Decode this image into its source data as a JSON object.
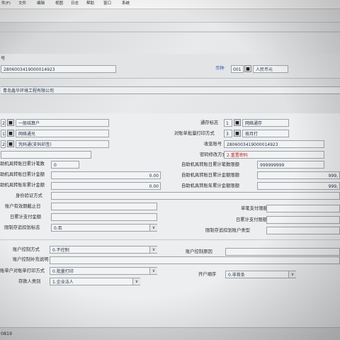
{
  "menu": {
    "items": [
      "件(F)",
      "文件",
      "编辑",
      "视图",
      "日志",
      "帮助",
      "窗口",
      "系统"
    ]
  },
  "header": {
    "label_fragment": "号",
    "account_value": "2806003419000014923",
    "currency_label": "币种",
    "currency_code": "001",
    "currency_name": "人民币元"
  },
  "customer": {
    "name": "青岛鑫华环境工程有限公司"
  },
  "left": {
    "field1": {
      "code": "2",
      "value": "一般结算户"
    },
    "field2": {
      "code": "1",
      "value": "网络通兑"
    },
    "field3": {
      "code": "2",
      "value": "凭码通(支码印签)"
    }
  },
  "right": {
    "transfer_flag": {
      "label": "通存标志",
      "code": "1",
      "value": "网络通存"
    },
    "print_mode": {
      "label": "对账单批量打印方式",
      "code": "3",
      "value": "按月打"
    },
    "receipt_account": {
      "label": "收息账号",
      "value": "2806003419000014923"
    },
    "password_change": {
      "label": "密码修改方式",
      "value": "2.重置密码"
    }
  },
  "limits": {
    "row1": {
      "left_label": "助机具转账日累计笔数",
      "left_value": "0",
      "right_label": "自助机具转账日累计笔数限额",
      "right_value": "999999999"
    },
    "row2": {
      "left_label": "助机具转账日累计金额",
      "left_value": "0.00",
      "right_label": "自助机具转账日累计金额限额",
      "right_value": "999,"
    },
    "row3": {
      "left_label": "助机具转账年累计金额",
      "left_value": "0.00",
      "right_label": "自助机具转账年累计金额限额",
      "right_value": "999,"
    }
  },
  "verify": {
    "label": "身份验证方式"
  },
  "misc": {
    "expiry_label": "账户有效期截止日",
    "single_limit_label": "单笔支付限额",
    "daily_amount_label": "日累计支付金额",
    "daily_limit_label": "日累计支付限额",
    "restrict_flag_label": "限制存追扣划标志",
    "restrict_flag_value": "0.否",
    "restrict_type_label": "限制存追扣划账户类型"
  },
  "control": {
    "method_label": "账户控制方式",
    "method_value": "0.不控制",
    "reason_label": "账户控制原因",
    "note_label": "账户控制补充说明"
  },
  "print": {
    "label": "账单户对账单打印方式",
    "value": "0.批量打印"
  },
  "order": {
    "label": "开户顺序",
    "value": "0.非首条"
  },
  "depositor": {
    "label": "存款人类别",
    "value": "1.企业法人"
  },
  "status": {
    "fragment": "0819"
  }
}
